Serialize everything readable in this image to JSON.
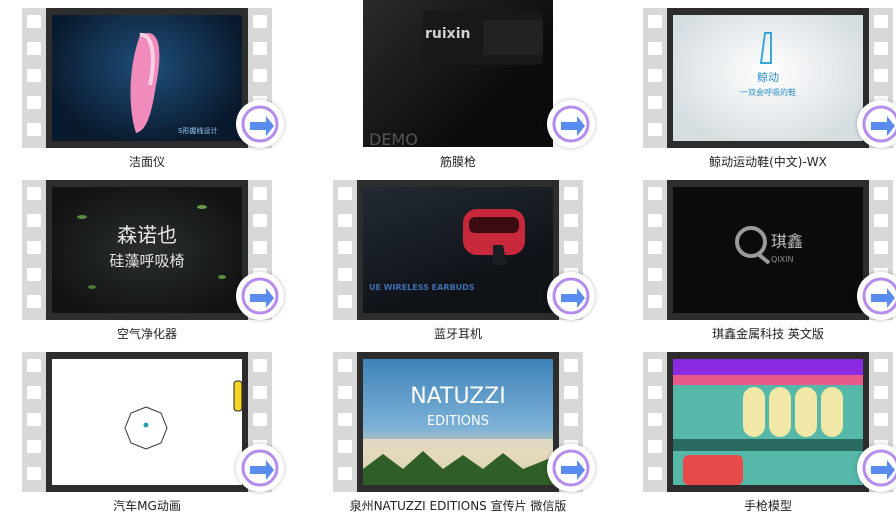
{
  "items": [
    {
      "caption": "洁面仪",
      "overlay": "S形握线设计"
    },
    {
      "caption": "筋膜枪",
      "overlay": "ruixin",
      "overlay2": "DEMO"
    },
    {
      "caption": "鲸动运动鞋(中文)-WX",
      "overlay": "鲸动",
      "overlay2": "一双会呼吸的鞋"
    },
    {
      "caption": "空气净化器",
      "overlay": "森诺也",
      "overlay2": "硅藻呼吸椅"
    },
    {
      "caption": "蓝牙耳机",
      "overlay": "UE WIRELESS EARBUDS"
    },
    {
      "caption": "琪鑫金属科技 英文版",
      "overlay": "琪鑫",
      "overlay2": "QIXIN"
    },
    {
      "caption": "汽车MG动画"
    },
    {
      "caption": "泉州NATUZZI EDITIONS 宣传片 微信版",
      "overlay": "NATUZZI",
      "overlay2": "EDITIONS"
    },
    {
      "caption": "手枪模型"
    }
  ],
  "icons": {
    "play_badge": "play-arrow-icon"
  },
  "colors": {
    "film": "#2d2d2d",
    "perforation": "#d8d8d8",
    "badge_arrow": "#5a8cf0"
  }
}
